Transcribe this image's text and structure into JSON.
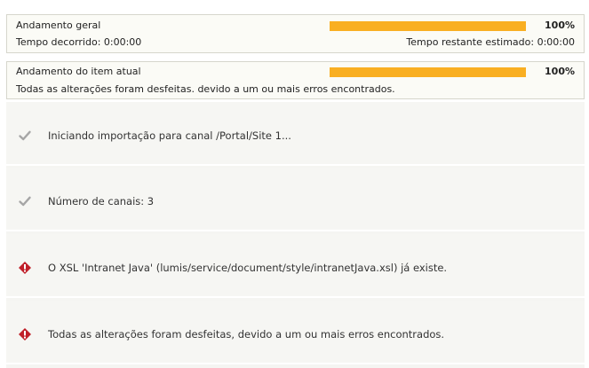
{
  "overall": {
    "label": "Andamento geral",
    "percent_text": "100%",
    "progress": 1.0,
    "elapsed": "Tempo decorrido: 0:00:00",
    "remaining": "Tempo restante estimado: 0:00:00"
  },
  "current_item": {
    "label": "Andamento do item atual",
    "percent_text": "100%",
    "progress": 1.0,
    "message": "Todas as alterações foram desfeitas. devido a um ou mais erros encontrados."
  },
  "colors": {
    "progress_fill": "#f9af22",
    "success_icon": "#a6a6a6",
    "error_icon": "#c0202a"
  },
  "log": [
    {
      "icon": "check-icon",
      "text": "Iniciando importação para canal /Portal/Site 1..."
    },
    {
      "icon": "check-icon",
      "text": "Número de canais: 3"
    },
    {
      "icon": "error-icon",
      "text": "O XSL 'Intranet Java' (lumis/service/document/style/intranetJava.xsl) já existe."
    },
    {
      "icon": "error-icon",
      "text": "Todas as alterações foram desfeitas, devido a um ou mais erros encontrados."
    }
  ]
}
